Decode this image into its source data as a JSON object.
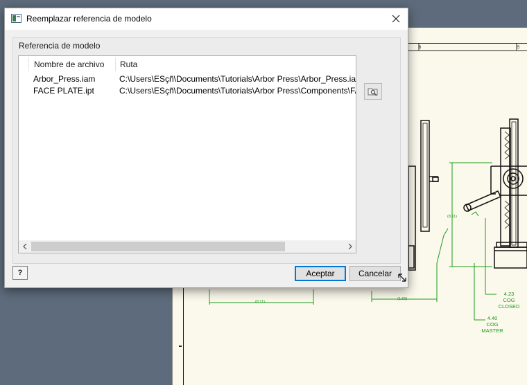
{
  "dialog": {
    "title": "Reemplazar referencia de modelo",
    "close_icon": "close-icon",
    "group_label": "Referencia de modelo",
    "columns": [
      "Nombre de archivo",
      "Ruta"
    ],
    "rows": [
      {
        "name": "Arbor_Press.iam",
        "path": "C:\\Users\\ESçñ\\Documents\\Tutorials\\Arbor Press\\Arbor_Press.iam"
      },
      {
        "name": "FACE PLATE.ipt",
        "path": "C:\\Users\\ESçñ\\Documents\\Tutorials\\Arbor Press\\Components\\FACE PLATE.ipt"
      }
    ],
    "browse_icon": "browse-folder-icon",
    "help_label": "?",
    "ok_label": "Aceptar",
    "cancel_label": "Cancelar"
  },
  "drawing": {
    "ruler_marks": [
      "6",
      "5"
    ],
    "dimensions": {
      "height_left": "(8.11)",
      "width_left": "(8.11)",
      "width_right": "(1.60)",
      "cog_closed_value": "4.23",
      "cog_closed_label_1": "COG",
      "cog_closed_label_2": "CLOSED",
      "cog_master_value": "4.40",
      "cog_master_label_1": "COG",
      "cog_master_label_2": "MASTER"
    }
  },
  "colors": {
    "dimension_green": "#1c9a1c",
    "accent_blue": "#0078d7",
    "sheet_bg": "#fbf9ec",
    "desktop_bg": "#5d6b7c"
  }
}
